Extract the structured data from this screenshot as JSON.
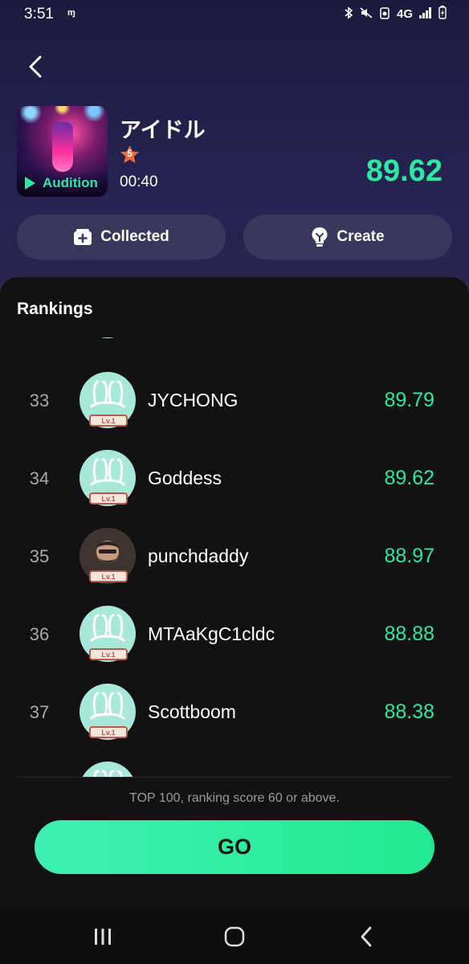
{
  "status_bar": {
    "time": "3:51",
    "small_label": "ɱ",
    "network": "4G",
    "icons": [
      "bluetooth-icon",
      "mute-icon",
      "data-saver-icon",
      "network-icon",
      "signal-icon",
      "battery-icon"
    ]
  },
  "song": {
    "title": "アイドル",
    "level": "5",
    "duration": "00:40",
    "score": "89.62",
    "audition_label": "Audition"
  },
  "actions": {
    "collected_label": "Collected",
    "create_label": "Create"
  },
  "rankings": {
    "heading": "Rankings",
    "badge_label": "Lv.1",
    "rows": [
      {
        "rank": "",
        "name": "",
        "score": "",
        "avatar": "bunny"
      },
      {
        "rank": "33",
        "name": "JYCHONG",
        "score": "89.79",
        "avatar": "bunny"
      },
      {
        "rank": "34",
        "name": "Goddess",
        "score": "89.62",
        "avatar": "bunny"
      },
      {
        "rank": "35",
        "name": "punchdaddy",
        "score": "88.97",
        "avatar": "photo"
      },
      {
        "rank": "36",
        "name": "MTAaKgC1cldc",
        "score": "88.88",
        "avatar": "bunny"
      },
      {
        "rank": "37",
        "name": "Scottboom",
        "score": "88.38",
        "avatar": "bunny"
      },
      {
        "rank": "",
        "name": "",
        "score": "",
        "avatar": "bunny"
      }
    ],
    "footnote": "TOP 100, ranking score 60 or above.",
    "go_label": "GO"
  },
  "colors": {
    "accent": "#2ee8a2",
    "header_bg": "#262351",
    "sheet_bg": "#121212",
    "button_bg": "#3a375c"
  }
}
